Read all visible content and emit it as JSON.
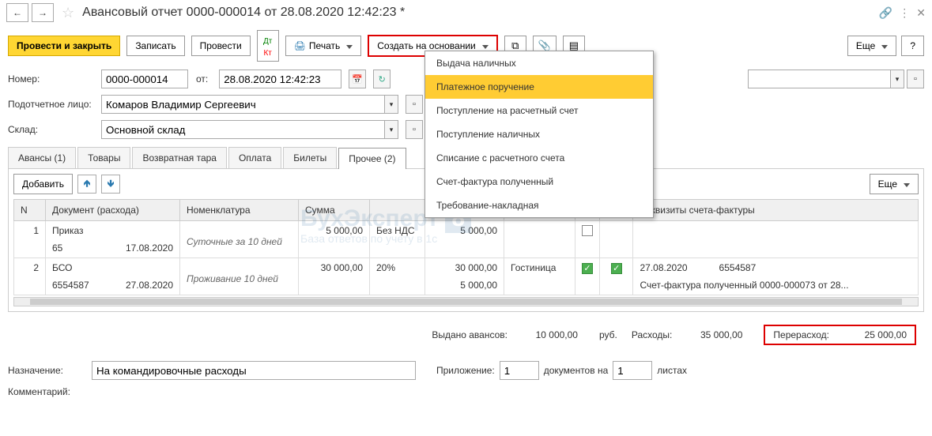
{
  "header": {
    "title": "Авансовый отчет 0000-000014 от 28.08.2020 12:42:23 *"
  },
  "toolbar": {
    "submit_close": "Провести и закрыть",
    "save": "Записать",
    "submit": "Провести",
    "print": "Печать",
    "create_from": "Создать на основании",
    "more": "Еще",
    "help": "?"
  },
  "menu": {
    "items": [
      "Выдача наличных",
      "Платежное поручение",
      "Поступление на расчетный счет",
      "Поступление наличных",
      "Списание с расчетного счета",
      "Счет-фактура полученный",
      "Требование-накладная"
    ],
    "active_index": 1
  },
  "fields": {
    "number_label": "Номер:",
    "number": "0000-000014",
    "date_label": "от:",
    "date": "28.08.2020 12:42:23",
    "person_label": "Подотчетное лицо:",
    "person": "Комаров Владимир Сергеевич",
    "warehouse_label": "Склад:",
    "warehouse": "Основной склад"
  },
  "tabs": [
    "Авансы (1)",
    "Товары",
    "Возвратная тара",
    "Оплата",
    "Билеты",
    "Прочее (2)"
  ],
  "tab_active": 5,
  "table": {
    "add": "Добавить",
    "more": "Еще",
    "cols": [
      "N",
      "Документ (расхода)",
      "Номенклатура",
      "Сумма",
      "",
      "",
      "",
      "",
      "БСО",
      "Реквизиты счета-фактуры"
    ],
    "rows": [
      {
        "n": "1",
        "doc1": "Приказ",
        "doc2": "65",
        "doc3": "17.08.2020",
        "nom": "Суточные за 10 дней",
        "sum": "5 000,00",
        "vat": "Без НДС",
        "total": "5 000,00",
        "supplier": "",
        "sf": false,
        "bso": false,
        "req1": "",
        "req2": ""
      },
      {
        "n": "2",
        "doc1": "БСО",
        "doc2": "6554587",
        "doc3": "27.08.2020",
        "nom": "Проживание 10 дней",
        "sum": "30 000,00",
        "vat": "20%",
        "total": "30 000,00",
        "vatsum": "5 000,00",
        "supplier": "Гостиница",
        "sf": true,
        "bso": true,
        "req1": "27.08.2020",
        "req2": "6554587",
        "req3": "Счет-фактура полученный 0000-000073 от 28..."
      }
    ]
  },
  "summary": {
    "advances_label": "Выдано авансов:",
    "advances": "10 000,00",
    "currency": "руб.",
    "expenses_label": "Расходы:",
    "expenses": "35 000,00",
    "overrun_label": "Перерасход:",
    "overrun": "25 000,00"
  },
  "bottom": {
    "purpose_label": "Назначение:",
    "purpose": "На командировочные расходы",
    "attachment_label": "Приложение:",
    "attachment": "1",
    "docs_on": "документов на",
    "sheets": "1",
    "sheets_label": "листах",
    "comment_label": "Комментарий:"
  },
  "watermark": {
    "t1": "БухЭксперт",
    "t2": "База ответов по учету в 1с",
    "badge": "8"
  }
}
